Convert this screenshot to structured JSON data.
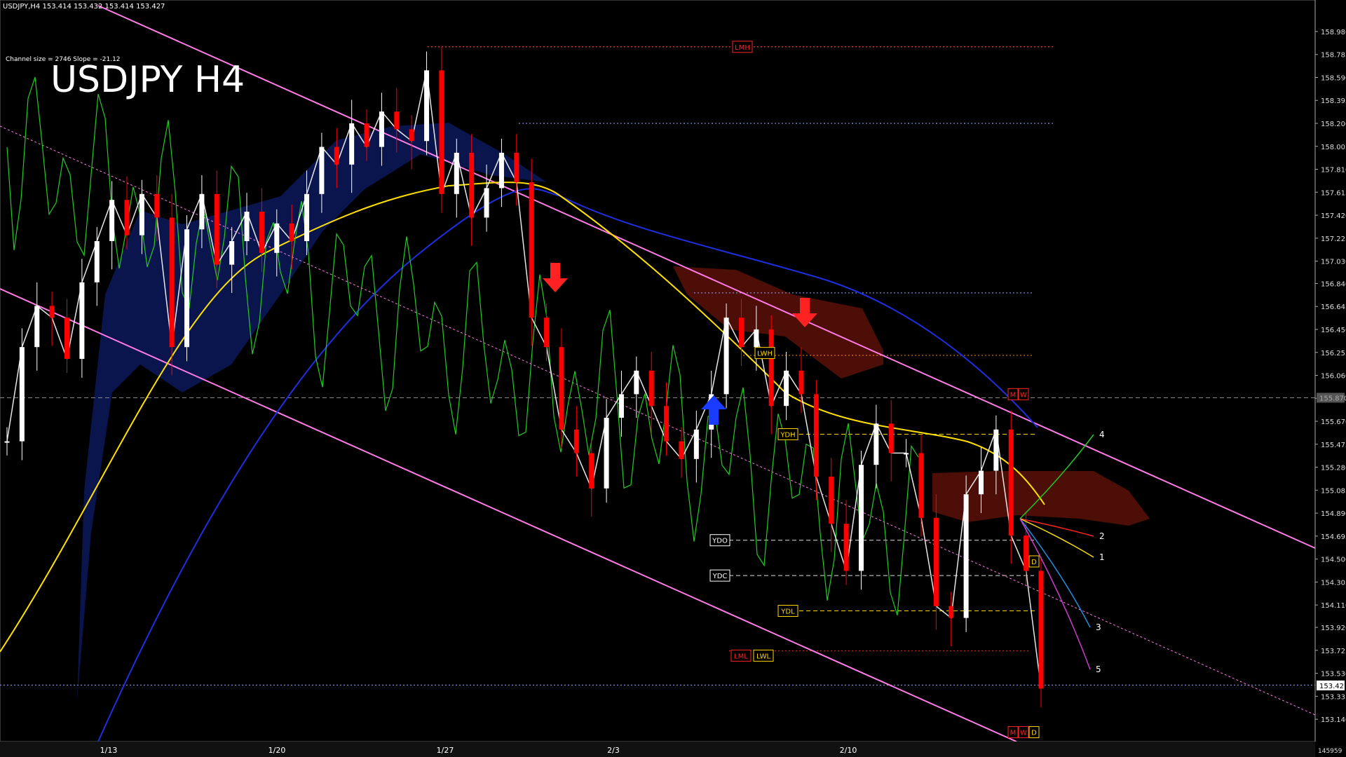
{
  "header": {
    "symbol_line": "USDJPY,H4  153.414 153.432 153.414 153.427",
    "channel_info": "Channel size = 2746 Slope = -21.12",
    "title": "USDJPY H4"
  },
  "chart_data": {
    "type": "candlestick",
    "symbol": "USDJPY",
    "timeframe": "H4",
    "ylim": [
      152.95,
      159.2
    ],
    "y_ticks": [
      "158.980",
      "158.785",
      "158.590",
      "158.395",
      "158.200",
      "158.005",
      "157.810",
      "157.615",
      "157.420",
      "157.225",
      "157.030",
      "156.840",
      "156.645",
      "156.450",
      "156.255",
      "156.060",
      "155.865",
      "155.670",
      "155.475",
      "155.280",
      "155.085",
      "154.890",
      "154.695",
      "154.500",
      "154.305",
      "154.110",
      "153.920",
      "153.725",
      "153.530",
      "153.335",
      "153.140"
    ],
    "x_ticks": [
      "1/13",
      "1/20",
      "1/27",
      "2/3",
      "2/10"
    ],
    "current_price": "153.427",
    "marked_level": "155.870",
    "footer_value": "145959",
    "close_points": [
      155.5,
      156.3,
      156.65,
      156.55,
      156.2,
      156.85,
      157.2,
      157.55,
      157.25,
      157.6,
      157.4,
      156.3,
      157.3,
      157.6,
      157.0,
      157.2,
      157.45,
      157.1,
      157.35,
      157.2,
      157.6,
      158.0,
      157.85,
      158.2,
      158.0,
      158.3,
      158.15,
      158.05,
      158.65,
      157.6,
      157.95,
      157.4,
      157.65,
      157.95,
      157.7,
      156.55,
      156.3,
      155.6,
      155.4,
      155.1,
      155.7,
      155.9,
      156.1,
      155.8,
      155.5,
      155.35,
      155.6,
      155.9,
      156.55,
      156.3,
      156.45,
      155.8,
      156.1,
      155.9,
      155.2,
      154.8,
      154.4,
      155.3,
      155.65,
      155.4,
      155.4,
      154.85,
      154.1,
      154.0,
      155.05,
      155.25,
      155.6,
      154.7,
      154.4,
      153.4
    ],
    "candle_colors": {
      "bull": "#ffffff",
      "bear": "#ff0000"
    },
    "horizontal_levels": [
      {
        "price": 158.85,
        "color": "#8fa6ff",
        "label": ""
      },
      {
        "price": 158.85,
        "color": "#ff2222",
        "label": "LMH"
      },
      {
        "price": 158.2,
        "color": "#8fa6ff",
        "label": ""
      },
      {
        "price": 156.76,
        "color": "#8fa6ff",
        "label": ""
      },
      {
        "price": 156.23,
        "color": "#ff8c00",
        "label": ""
      },
      {
        "price": 155.87,
        "color": "#888888",
        "label": ""
      },
      {
        "price": 153.72,
        "color": "#ff2222",
        "label": ""
      },
      {
        "price": 153.43,
        "color": "#8fa6ff",
        "label": ""
      }
    ],
    "tags": [
      {
        "text": "LMH",
        "color": "#ff2222",
        "price": 158.85
      },
      {
        "text": "LWH",
        "color": "#ffd700",
        "price": 156.25
      },
      {
        "text": "YDH",
        "color": "#ffd700",
        "price": 155.56
      },
      {
        "text": "YDO",
        "color": "#ffffff",
        "price": 154.66
      },
      {
        "text": "YDC",
        "color": "#ffffff",
        "price": 154.36
      },
      {
        "text": "YDL",
        "color": "#ffd700",
        "price": 154.06
      },
      {
        "text": "LML",
        "color": "#ff2222",
        "price": 153.68
      },
      {
        "text": "LWL",
        "color": "#ffd700",
        "price": 153.68
      },
      {
        "text": "M",
        "color": "#ff2222",
        "price": 155.9
      },
      {
        "text": "W",
        "color": "#ff2222",
        "price": 155.9
      },
      {
        "text": "D",
        "color": "#ffd700",
        "price": 154.48
      },
      {
        "text": "M",
        "color": "#ff2222",
        "price": 153.03
      },
      {
        "text": "W",
        "color": "#ff2222",
        "price": 153.03
      },
      {
        "text": "D",
        "color": "#ffd700",
        "price": 153.03
      }
    ],
    "projection_labels": [
      "4",
      "2",
      "1",
      "3",
      "5"
    ],
    "arrows": [
      {
        "dir": "down",
        "color": "#ff2222"
      },
      {
        "dir": "down",
        "color": "#ff2222"
      },
      {
        "dir": "up",
        "color": "#1a3cff"
      }
    ]
  }
}
